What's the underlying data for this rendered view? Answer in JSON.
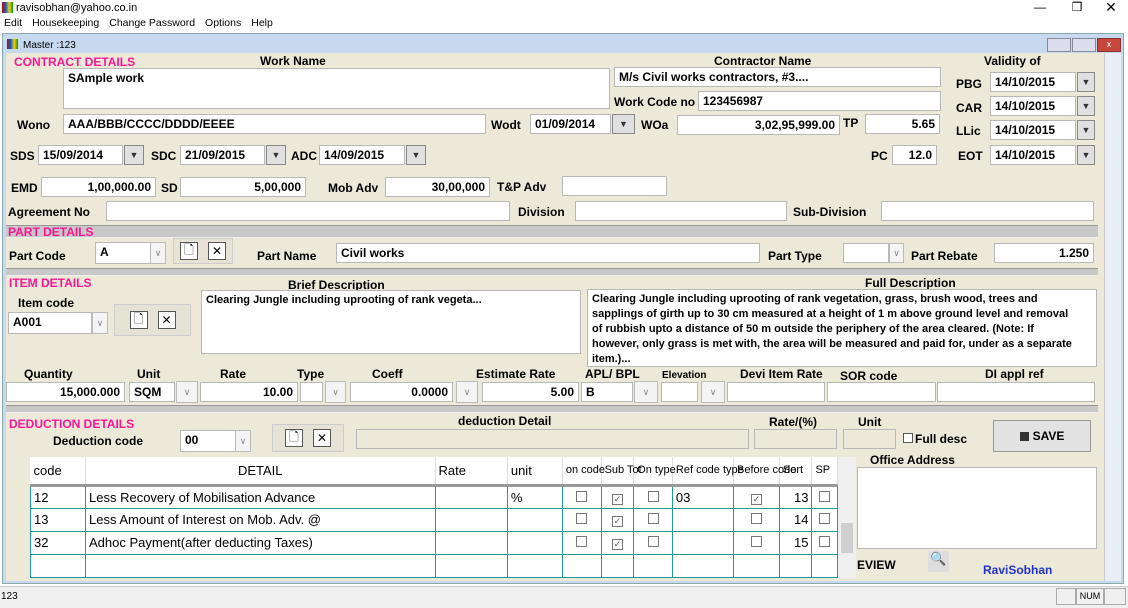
{
  "app": {
    "title": "ravisobhan@yahoo.co.in",
    "menu": [
      "Edit",
      "Housekeeping",
      "Change Password",
      "Options",
      "Help"
    ]
  },
  "child": {
    "title": "Master :123"
  },
  "contract": {
    "section": "CONTRACT DETAILS",
    "work_name_label": "Work Name",
    "work_name": "SAmple work",
    "contractor_label": "Contractor Name",
    "contractor": "M/s Civil works contractors, #3....",
    "work_code_label": "Work Code no",
    "work_code": "123456987",
    "validity_label": "Validity of",
    "pbg_label": "PBG",
    "pbg": "14/10/2015",
    "car_label": "CAR",
    "car": "14/10/2015",
    "llic_label": "LLic",
    "llic": "14/10/2015",
    "eot_label": "EOT",
    "eot": "14/10/2015",
    "wono_label": "Wono",
    "wono": "AAA/BBB/CCCC/DDDD/EEEE",
    "wodt_label": "Wodt",
    "wodt": "01/09/2014",
    "woa_label": "WOa",
    "woa": "3,02,95,999.00",
    "tp_label": "TP",
    "tp": "5.65",
    "sds_label": "SDS",
    "sds": "15/09/2014",
    "sdc_label": "SDC",
    "sdc": "21/09/2015",
    "adc_label": "ADC",
    "adc": "14/09/2015",
    "pc_label": "PC",
    "pc": "12.0",
    "emd_label": "EMD",
    "emd": "1,00,000.00",
    "sd_label": "SD",
    "sd": "5,00,000",
    "mob_label": "Mob Adv",
    "mob": "30,00,000",
    "tp_adv_label": "T&P Adv",
    "tp_adv": "",
    "agreement_label": "Agreement No",
    "agreement": "",
    "division_label": "Division",
    "division": "",
    "subdivision_label": "Sub-Division",
    "subdivision": ""
  },
  "part": {
    "section": "PART DETAILS",
    "code_label": "Part Code",
    "code": "A",
    "name_label": "Part Name",
    "name": "Civil works",
    "type_label": "Part Type",
    "type": "",
    "rebate_label": "Part Rebate",
    "rebate": "1.250"
  },
  "item": {
    "section": "ITEM DETAILS",
    "code_label": "Item code",
    "code": "A001",
    "brief_label": "Brief Description",
    "brief": "Clearing Jungle including uprooting of rank vegeta...",
    "full_label": "Full Description",
    "full": "Clearing Jungle including uprooting of rank vegetation, grass, brush wood, trees and sapplings of girth up to 30 cm measured at a height of 1 m above ground level and removal of rubbish upto a distance of 50 m outside the periphery of the area cleared. (Note: If however, only grass is met with, the area will be measured and paid for, under as a separate item.)...",
    "labels": {
      "quantity": "Quantity",
      "unit": "Unit",
      "rate": "Rate",
      "type": "Type",
      "coeff": "Coeff",
      "estimate": "Estimate Rate",
      "apl": "APL/ BPL",
      "elevation": "Elevation",
      "devi": "Devi Item Rate",
      "sor": "SOR code",
      "di": "DI appl ref"
    },
    "quantity": "15,000.000",
    "unit": "SQM",
    "rate": "10.00",
    "type": "",
    "coeff": "0.0000",
    "estimate": "5.00",
    "apl": "B",
    "elevation": "",
    "devi": "",
    "sor": "",
    "di": ""
  },
  "deduction": {
    "section": "DEDUCTION DETAILS",
    "code_label": "Deduction code",
    "code": "00",
    "detail_label": "deduction Detail",
    "rate_label": "Rate/(%)",
    "unit_label": "Unit",
    "full_desc": "Full desc",
    "save": "SAVE",
    "columns": [
      "code",
      "DETAIL",
      "Rate",
      "unit",
      "on code",
      "Sub Tot",
      "On type",
      "Ref code type",
      "Before code",
      "Sort",
      "SP"
    ],
    "rows": [
      {
        "code": "12",
        "detail": "Less Recovery of Mobilisation Advance",
        "rate": "",
        "unit": "%",
        "on_code": false,
        "sub_tot": true,
        "on_type": false,
        "ref": "03",
        "before": true,
        "sort": "13",
        "sp": false
      },
      {
        "code": "13",
        "detail": "Less Amount of Interest on Mob. Adv. @",
        "rate": "",
        "unit": "",
        "on_code": false,
        "sub_tot": true,
        "on_type": false,
        "ref": "",
        "before": false,
        "sort": "14",
        "sp": false
      },
      {
        "code": "32",
        "detail": "Adhoc Payment(after deducting Taxes)",
        "rate": "",
        "unit": "",
        "on_code": false,
        "sub_tot": true,
        "on_type": false,
        "ref": "",
        "before": false,
        "sort": "15",
        "sp": false
      }
    ],
    "office_label": "Office Address",
    "office": "",
    "preview": "EVIEW",
    "author": "RaviSobhan"
  },
  "status": {
    "text": "123",
    "num": "NUM"
  }
}
